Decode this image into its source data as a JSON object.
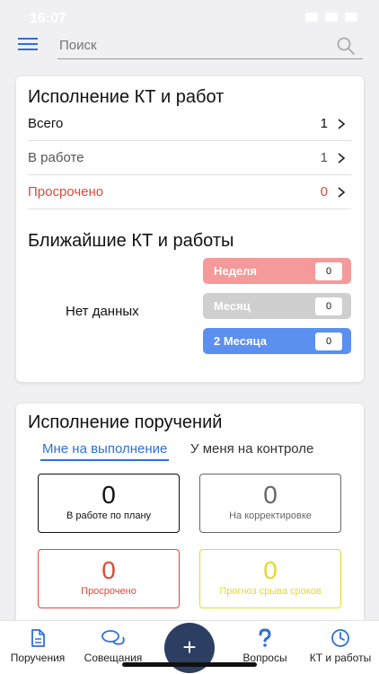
{
  "status_bar": {
    "time": "16:07"
  },
  "search": {
    "placeholder": "Поиск"
  },
  "kt_card": {
    "title": "Исполнение КТ и работ",
    "rows": [
      {
        "label": "Всего",
        "count": "1",
        "color": "#111111"
      },
      {
        "label": "В работе",
        "count": "1",
        "color": "#555555"
      },
      {
        "label": "Просрочено",
        "count": "0",
        "color": "#e0483a"
      }
    ],
    "upcoming_title": "Ближайшие КТ и работы",
    "no_data": "Нет данных",
    "periods": [
      {
        "label": "Неделя",
        "value": "0",
        "color": "#f59a9a"
      },
      {
        "label": "Месяц",
        "value": "0",
        "color": "#cfcfcf"
      },
      {
        "label": "2 Месяца",
        "value": "0",
        "color": "#5b8ff0"
      }
    ]
  },
  "orders_card": {
    "title": "Исполнение поручений",
    "tabs": [
      {
        "label": "Мне на выполнение",
        "active": true
      },
      {
        "label": "У меня на контроле",
        "active": false
      }
    ],
    "stats": [
      {
        "value": "0",
        "label": "В работе по плану",
        "color": "#111111"
      },
      {
        "value": "0",
        "label": "На корректировке",
        "color": "#666666"
      },
      {
        "value": "0",
        "label": "Просрочено",
        "color": "#e0483a"
      },
      {
        "value": "0",
        "label": "Прогноз срыва сроков",
        "color": "#e5d82a"
      }
    ]
  },
  "bottom_nav": {
    "items": [
      {
        "label": "Поручения",
        "icon": "document-icon"
      },
      {
        "label": "Совещания",
        "icon": "chat-bubbles-icon"
      },
      {
        "label": "+",
        "icon": "plus-icon"
      },
      {
        "label": "Вопросы",
        "icon": "question-icon"
      },
      {
        "label": "КТ и работы",
        "icon": "clock-icon"
      }
    ]
  },
  "accent_color": "#2f6fd8"
}
